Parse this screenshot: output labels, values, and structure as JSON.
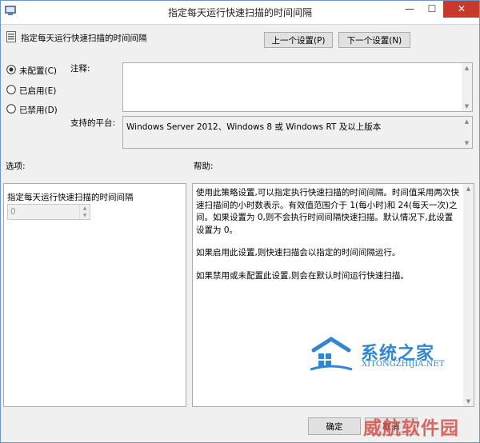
{
  "window": {
    "title": "指定每天运行快速扫描的时间间隔"
  },
  "header": {
    "policy_name": "指定每天运行快速扫描的时间间隔",
    "prev_label": "上一个设置(P)",
    "next_label": "下一个设置(N)"
  },
  "state": {
    "options": [
      {
        "label": "未配置(C)",
        "selected": true
      },
      {
        "label": "已启用(E)",
        "selected": false
      },
      {
        "label": "已禁用(D)",
        "selected": false
      }
    ]
  },
  "comment": {
    "label": "注释:",
    "value": ""
  },
  "platform": {
    "label": "支持的平台:",
    "value": "Windows Server 2012、Windows 8 或 Windows RT 及以上版本"
  },
  "options_panel": {
    "label": "选项:",
    "field_label": "指定每天运行快速扫描的时间间隔",
    "value": "0"
  },
  "help_panel": {
    "label": "帮助:",
    "paragraphs": [
      "使用此策略设置,可以指定执行快速扫描的时间间隔。时间值采用两次快速扫描间的小时数表示。有效值范围介于 1(每小时)和 24(每天一次)之间。如果设置为 0,则不会执行时间间隔快速扫描。默认情况下,此设置设置为 0。",
      "如果启用此设置,则快速扫描会以指定的时间间隔运行。",
      "如果禁用或未配置此设置,则会在默认时间运行快速扫描。"
    ]
  },
  "footer": {
    "ok_label": "确定",
    "cancel_label": "取消"
  },
  "watermark": {
    "name": "系统之家",
    "url": "XITONGZHIJIA.NET",
    "secondary": "威航软件园"
  },
  "colors": {
    "accent": "#2f86d4",
    "close": "#c7392b",
    "watermark2": "#d9534f"
  }
}
